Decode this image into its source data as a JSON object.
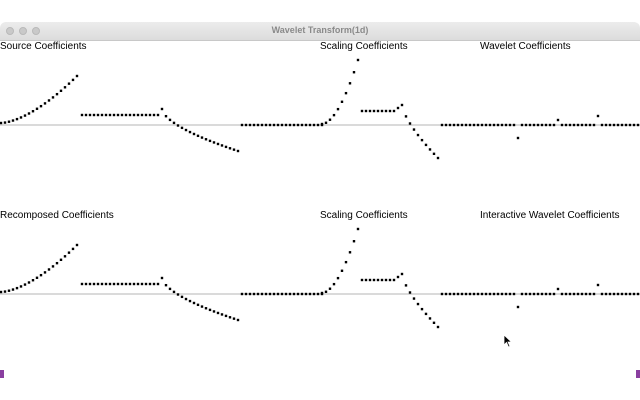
{
  "window": {
    "title": "Wavelet Transform(1d)"
  },
  "panels": [
    {
      "id": "source",
      "label": "Source Coefficients"
    },
    {
      "id": "scaling-top",
      "label": "Scaling Coefficients"
    },
    {
      "id": "wavelet-top",
      "label": "Wavelet Coefficients"
    },
    {
      "id": "recomposed",
      "label": "Recomposed Coefficients"
    },
    {
      "id": "scaling-bottom",
      "label": "Scaling Coefficients"
    },
    {
      "id": "wavelet-bottom",
      "label": "Interactive Wavelet Coefficients"
    }
  ]
}
